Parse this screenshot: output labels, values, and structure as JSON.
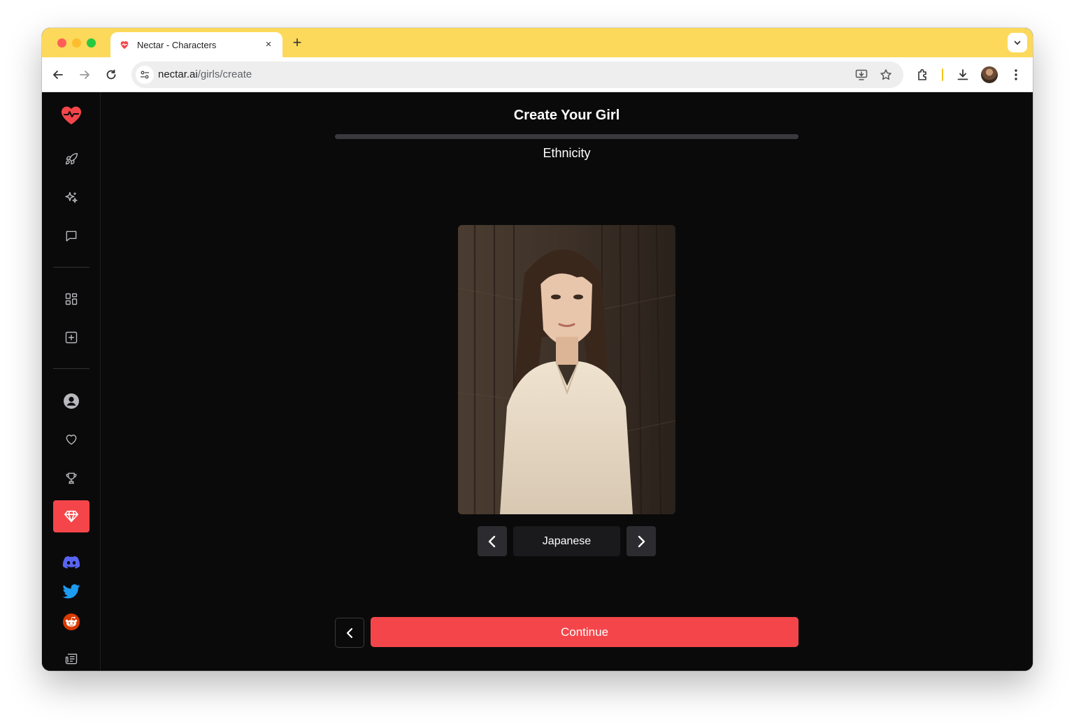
{
  "browser": {
    "tab_title": "Nectar - Characters",
    "tab_close": "×",
    "new_tab": "+",
    "url_domain": "nectar.ai",
    "url_path": "/girls/create"
  },
  "sidebar": {
    "items": [
      {
        "name": "nectar-logo-icon"
      },
      {
        "name": "rocket-icon"
      },
      {
        "name": "sparkles-icon"
      },
      {
        "name": "chat-icon"
      },
      {
        "name": "gallery-grid-icon"
      },
      {
        "name": "create-plus-icon"
      },
      {
        "name": "profile-icon"
      },
      {
        "name": "heart-icon"
      },
      {
        "name": "trophy-icon"
      },
      {
        "name": "diamond-icon",
        "active": true
      },
      {
        "name": "discord-icon"
      },
      {
        "name": "twitter-icon"
      },
      {
        "name": "reddit-icon"
      },
      {
        "name": "news-icon"
      }
    ],
    "accent_color": "#f4464a"
  },
  "main": {
    "title": "Create Your Girl",
    "step_label": "Ethnicity",
    "progress_fraction": 0.0,
    "selector": {
      "value": "Japanese",
      "prev_icon": "chevron-left-icon",
      "next_icon": "chevron-right-icon"
    },
    "continue_label": "Continue",
    "back_icon": "chevron-left-icon"
  }
}
